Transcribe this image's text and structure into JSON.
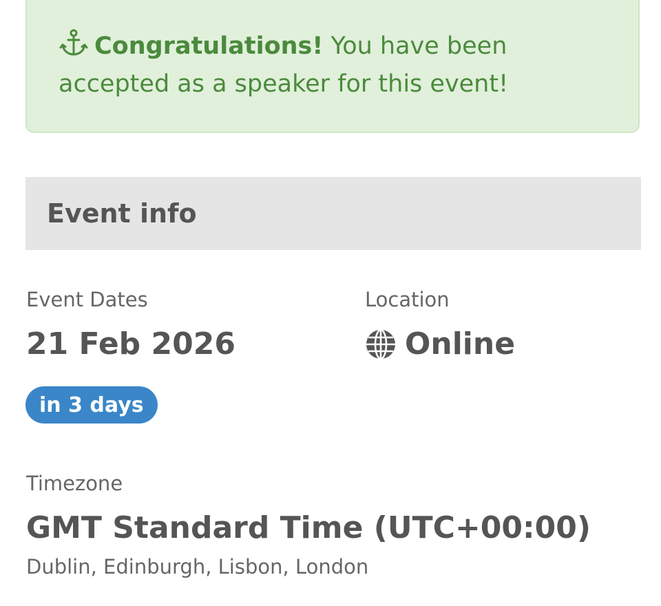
{
  "alert": {
    "icon": "anchor-icon",
    "strong_text": "Congratulations!",
    "message": " You have been accepted as a speaker for this event!",
    "color": "#4b8a3d",
    "background": "#e1f0db"
  },
  "event_info": {
    "header": "Event info",
    "dates": {
      "label": "Event Dates",
      "value": "21 Feb 2026",
      "badge": "in 3 days",
      "badge_color": "#3a86c8"
    },
    "location": {
      "label": "Location",
      "icon": "globe-icon",
      "value": "Online"
    },
    "timezone": {
      "label": "Timezone",
      "value": "GMT Standard Time (UTC+00:00)",
      "cities": "Dublin, Edinburgh, Lisbon, London"
    }
  }
}
